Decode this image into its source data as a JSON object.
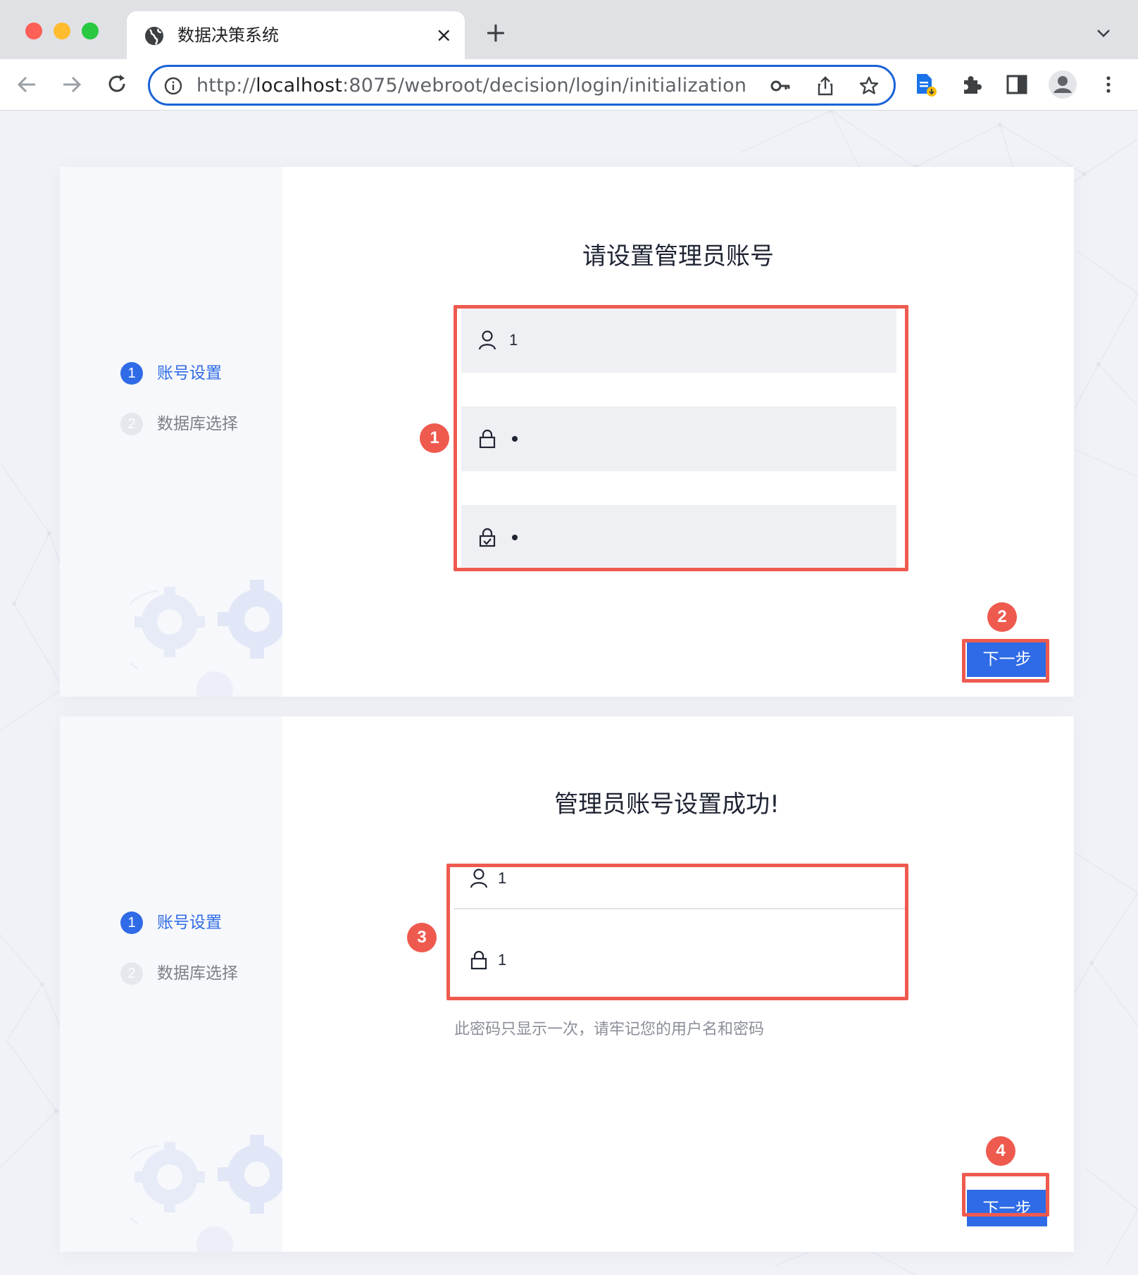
{
  "browser": {
    "tab_title": "数据决策系统",
    "tab_close": "×",
    "new_tab": "+",
    "url_prefix": "http://",
    "url_host": "localhost",
    "url_rest": ":8075/webroot/decision/login/initialization"
  },
  "steps": [
    {
      "num": "1",
      "label": "账号设置",
      "state": "active"
    },
    {
      "num": "2",
      "label": "数据库选择",
      "state": "inactive"
    }
  ],
  "card1": {
    "heading": "请设置管理员账号",
    "username_value": "1",
    "password_masked": "•",
    "confirm_masked": "•",
    "next_button": "下一步"
  },
  "card2": {
    "heading": "管理员账号设置成功!",
    "username_value": "1",
    "password_value": "1",
    "hint": "此密码只显示一次，请牢记您的用户名和密码",
    "next_button": "下一步"
  },
  "annotations": [
    "1",
    "2",
    "3",
    "4"
  ],
  "colors": {
    "accent": "#2f6be6",
    "annotation_red": "#ef5a4f",
    "field_bg": "#eff0f4"
  }
}
